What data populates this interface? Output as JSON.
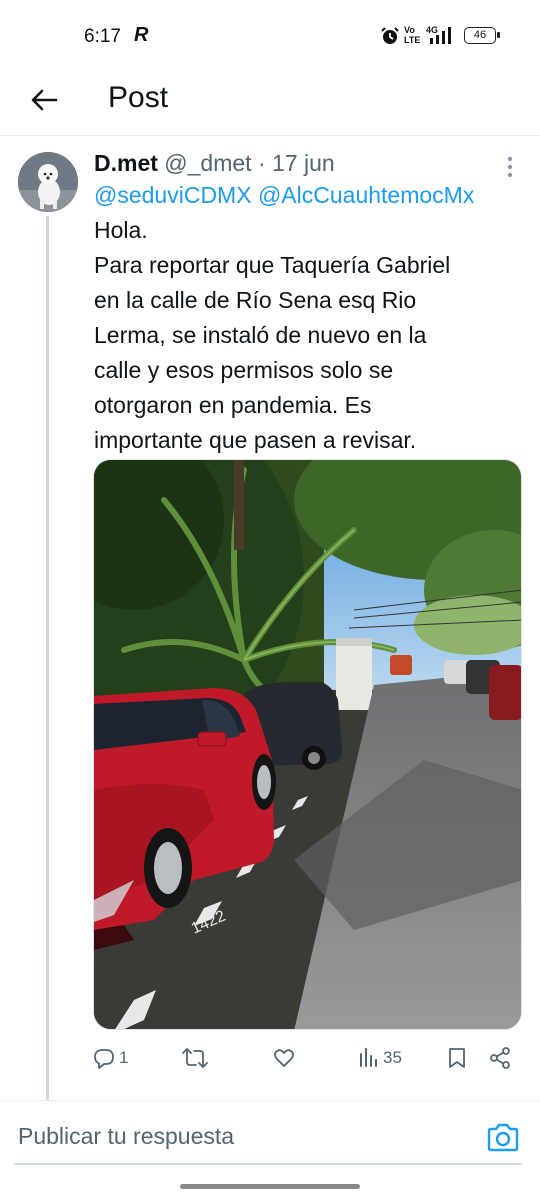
{
  "status_bar": {
    "time": "6:17",
    "app_icon": "R",
    "volte": "Vo\nLTE",
    "network": "4G",
    "battery": "46"
  },
  "header": {
    "back_icon": "arrow-left-icon",
    "title": "Post"
  },
  "tweet": {
    "author_name": "D.met",
    "author_handle": "@_dmet",
    "separator": "·",
    "date": "17 jun",
    "mentions": [
      "@seduviCDMX",
      "@AlcCuauhtemocMx"
    ],
    "text_lines": [
      "Hola.",
      "Para reportar que Taquería Gabriel",
      "en la calle de Río Sena esq Rio",
      "Lerma, se instaló de nuevo en la",
      "calle y esos permisos solo se",
      "otorgaron en pandemia. Es",
      "importante que pasen a revisar."
    ],
    "photo_curb_number": "1422"
  },
  "actions": {
    "reply_count": "1",
    "retweet_count": "",
    "like_count": "",
    "views_count": "35"
  },
  "reply_bar": {
    "placeholder": "Publicar tu respuesta"
  },
  "colors": {
    "accent": "#1d9bf0",
    "text": "#0f1419",
    "muted": "#536471",
    "car_red": "#c0192a"
  }
}
